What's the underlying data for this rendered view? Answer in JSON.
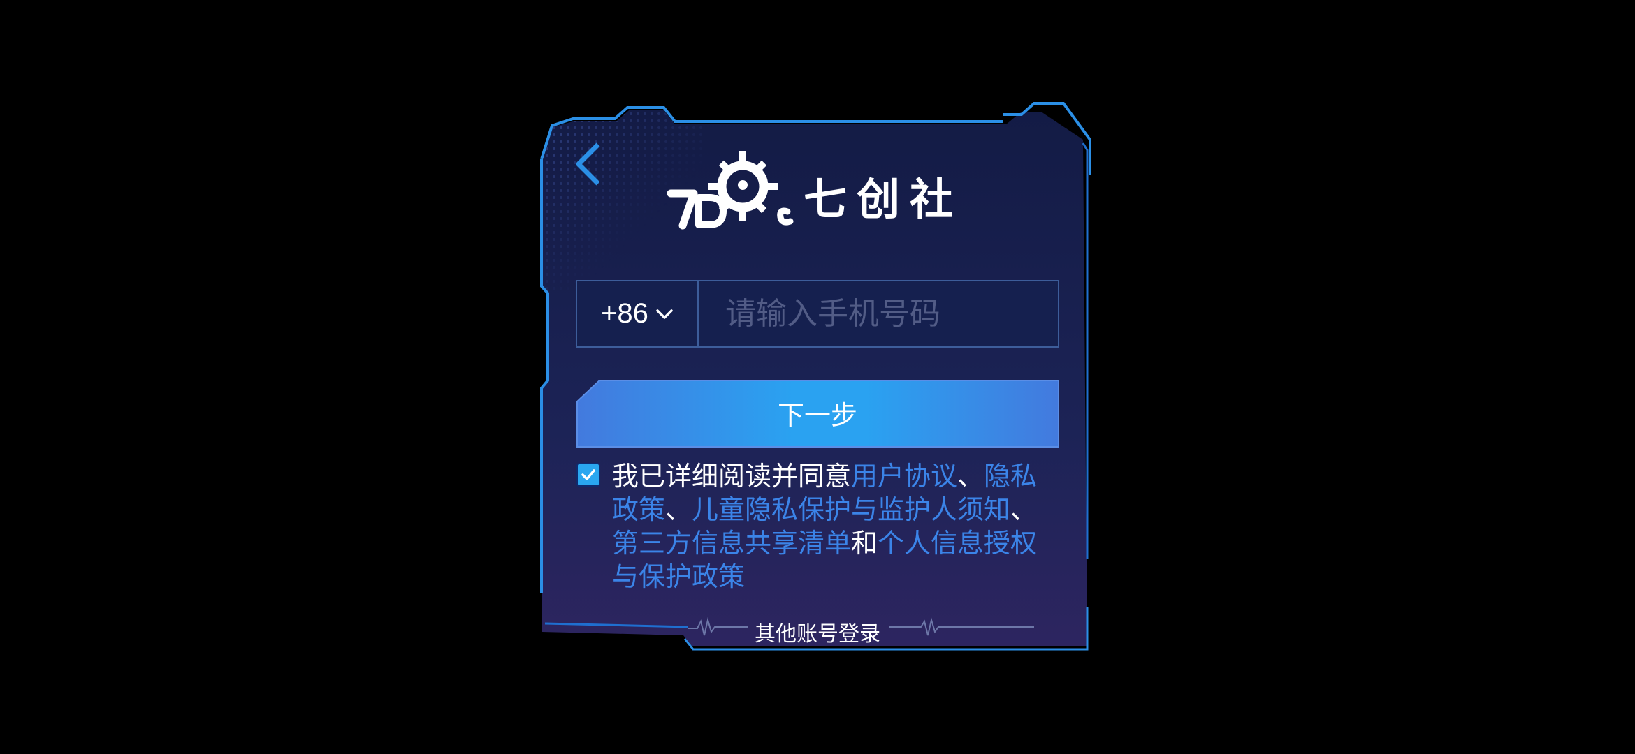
{
  "header": {
    "back_icon": "chevron-left-icon",
    "logo_brand_text": "七创社"
  },
  "phone": {
    "country_code": "+86",
    "country_code_icon": "chevron-down-icon",
    "placeholder": "请输入手机号码",
    "value": ""
  },
  "next_button": {
    "label": "下一步"
  },
  "agreement": {
    "checked": true,
    "prefix": "我已详细阅读并同意",
    "link_user_agreement": "用户协议",
    "sep1": "、",
    "link_privacy_policy": "隐私政策",
    "sep2": "、",
    "link_children_privacy": "儿童隐私保护与监护人须知",
    "sep3": "、",
    "link_third_party": "第三方信息共享清单",
    "conj": "和",
    "link_personal_info": "个人信息授权与保护政策"
  },
  "other_login": {
    "label": "其他账号登录"
  },
  "colors": {
    "background": "#000000",
    "panel_top": "#131b45",
    "panel_bottom": "#2d2560",
    "frame": "#2b8fe6",
    "link": "#3b84e8",
    "button_gradient_mid": "#2a9ff0",
    "button_gradient_edge": "#437ade"
  }
}
